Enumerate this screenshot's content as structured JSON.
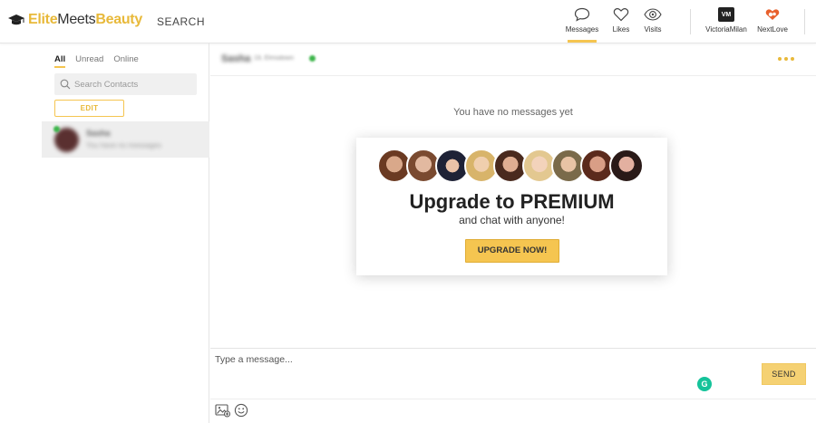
{
  "header": {
    "logo_part1": "Elite",
    "logo_part2": "Meets",
    "logo_part3": "Beauty",
    "search_label": "SEARCH",
    "nav": {
      "messages": "Messages",
      "likes": "Likes",
      "visits": "Visits",
      "victoriamilan": "VictoriaMilan",
      "victoriamilan_badge": "VM",
      "nextlove": "NextLove"
    }
  },
  "sidebar": {
    "tabs": [
      "All",
      "Unread",
      "Online"
    ],
    "search_placeholder": "Search Contacts",
    "edit_label": "EDIT",
    "contact": {
      "name": "Sasha",
      "preview": "You have no messages"
    }
  },
  "chat": {
    "name": "Sasha",
    "sub": "19, Elmsdown",
    "empty_text": "You have no messages yet"
  },
  "premium": {
    "title": "Upgrade to PREMIUM",
    "subtitle": "and chat with anyone!",
    "button": "UPGRADE NOW!"
  },
  "composer": {
    "placeholder": "Type a message...",
    "send_label": "SEND",
    "grammarly_badge": "G"
  },
  "colors": {
    "accent": "#f5c550",
    "online": "#3cb54a"
  }
}
